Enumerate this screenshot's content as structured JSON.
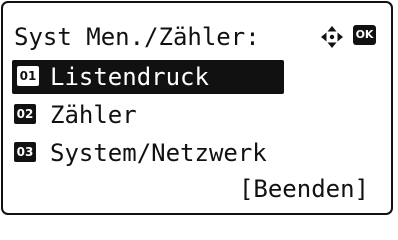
{
  "screen": {
    "title": "Syst Men./Zähler:",
    "icons": {
      "navigate": "four-way-arrow-icon",
      "ok": "OK"
    }
  },
  "menu": {
    "items": [
      {
        "number": "01",
        "label": "Listendruck",
        "selected": true
      },
      {
        "number": "02",
        "label": "Zähler",
        "selected": false
      },
      {
        "number": "03",
        "label": "System/Netzwerk",
        "selected": false
      }
    ],
    "end_label": "[Beenden]"
  },
  "colors": {
    "foreground": "#111111",
    "background": "#ffffff"
  }
}
